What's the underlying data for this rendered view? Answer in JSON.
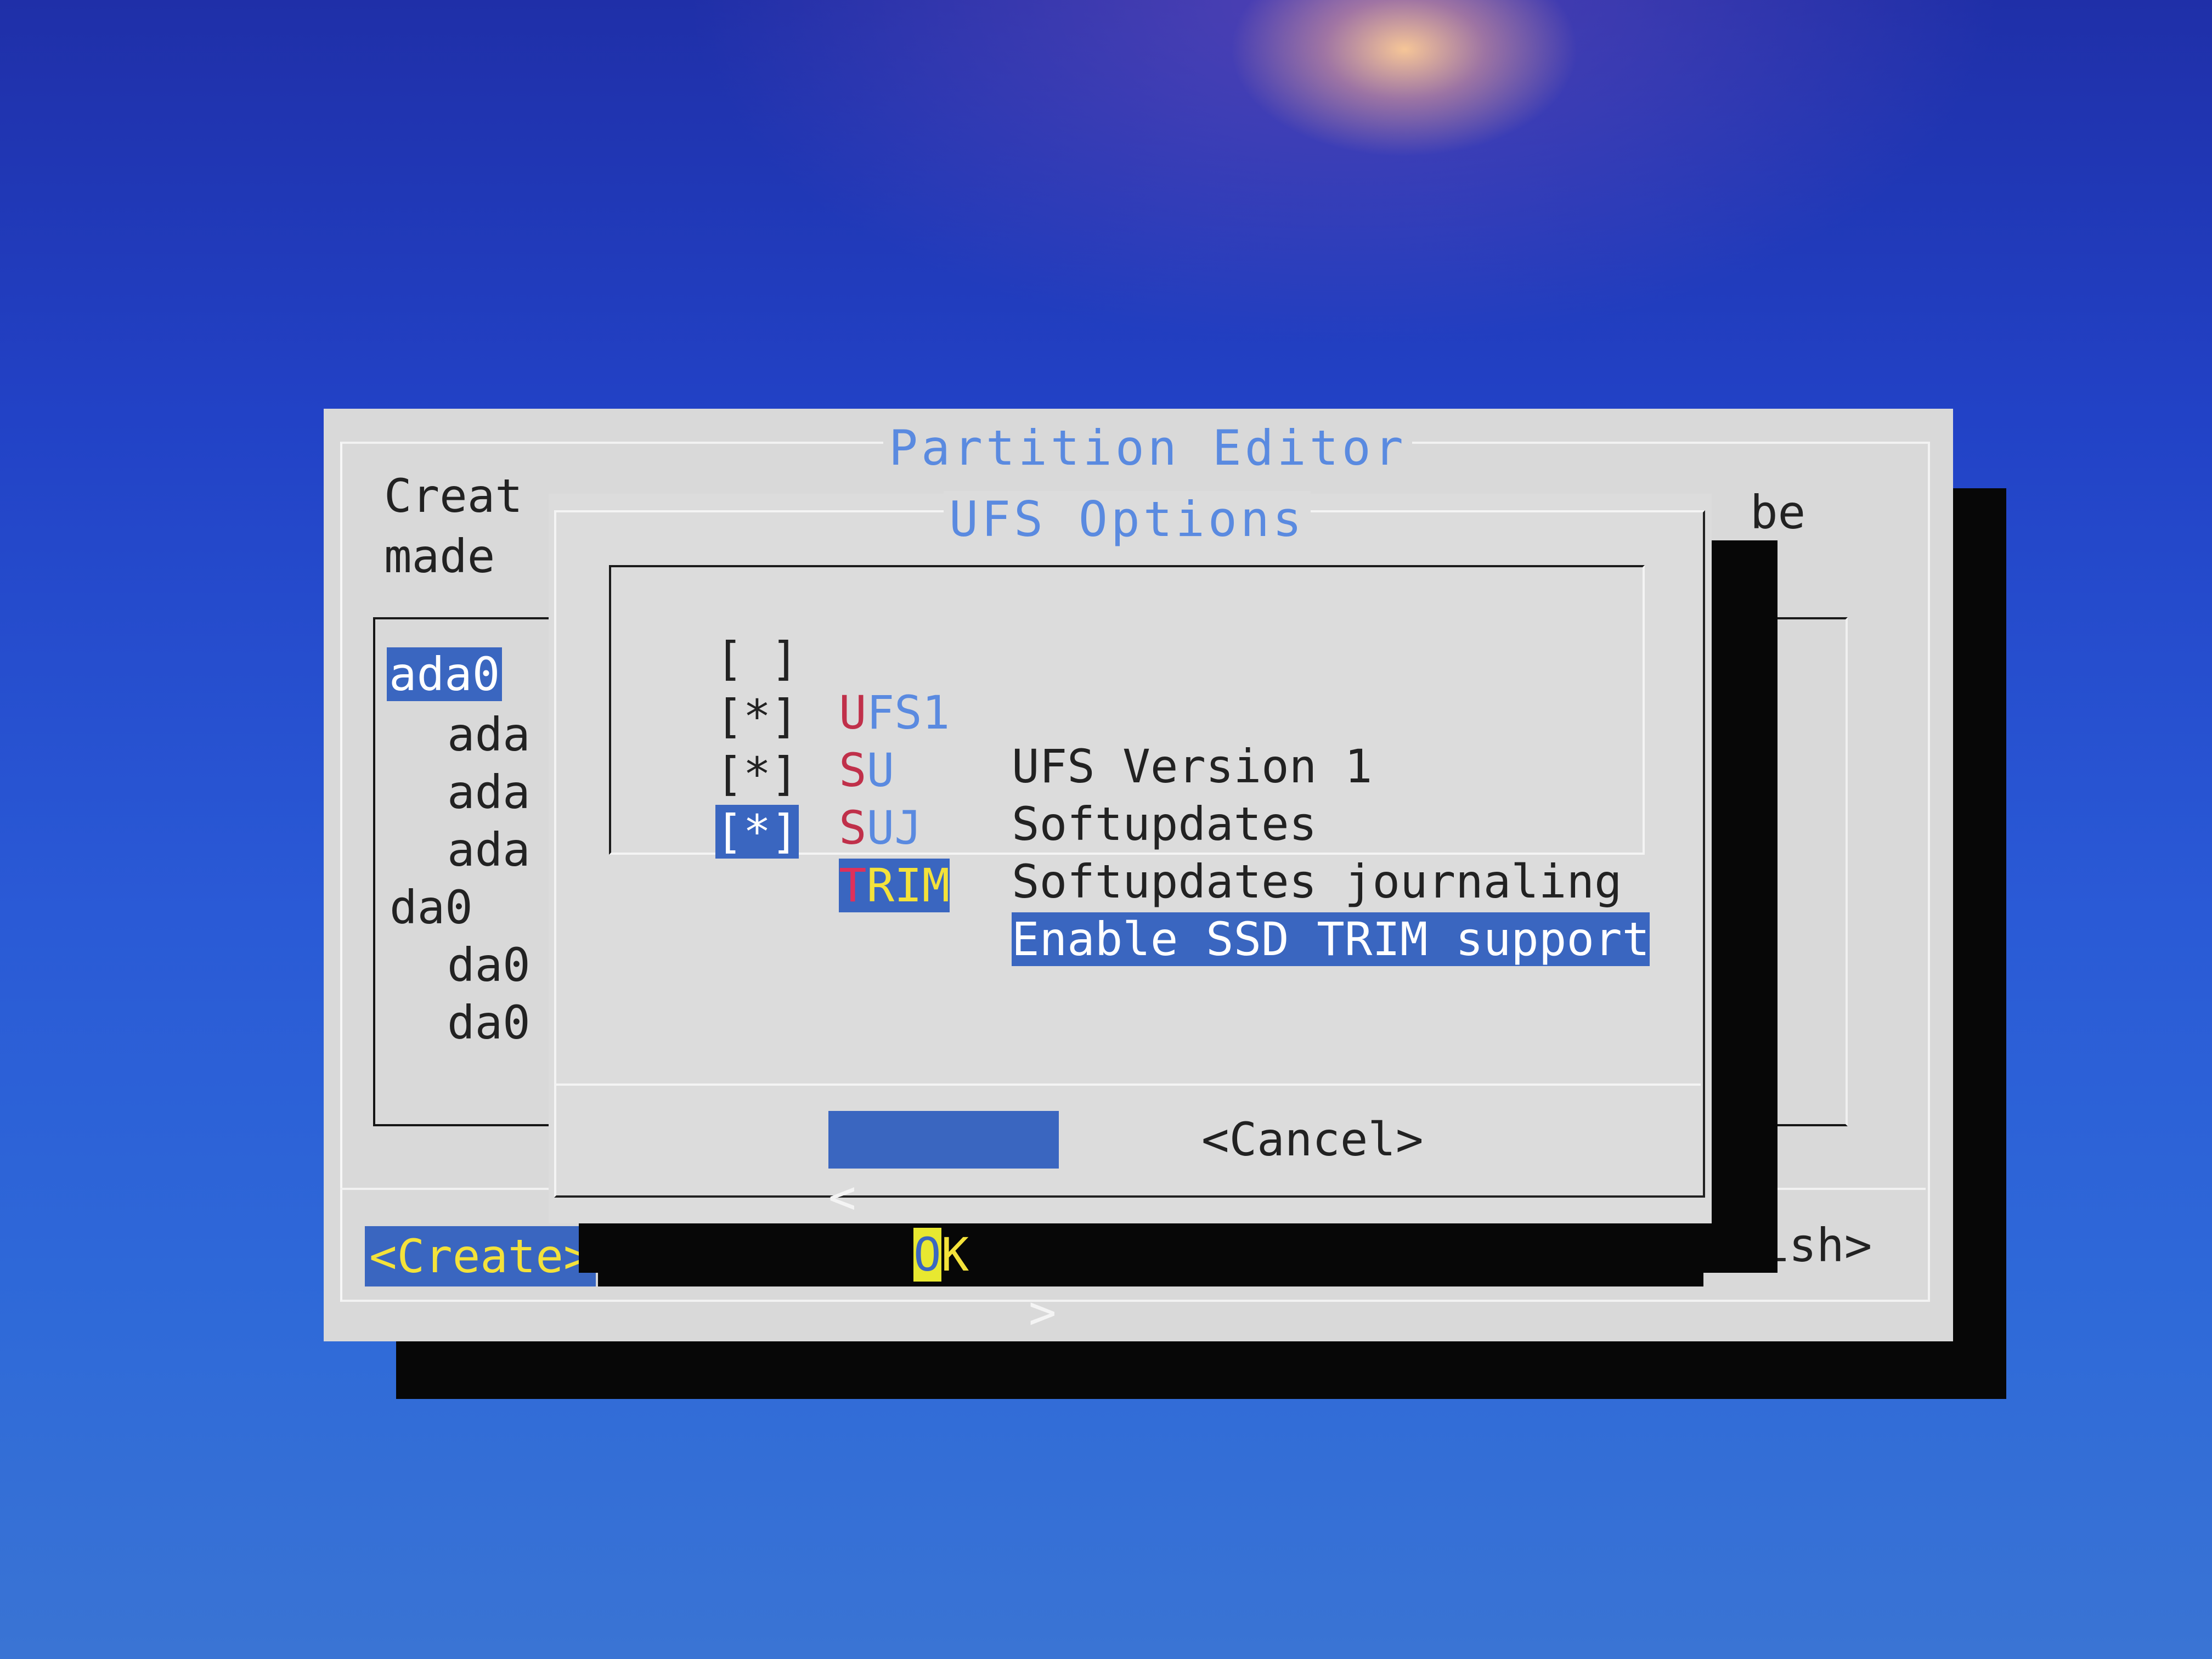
{
  "outer_dialog": {
    "title": "Partition Editor",
    "description_line1": "Creat",
    "description_line2": "made",
    "description_right": "be",
    "disks": [
      "ada0",
      "ada",
      "ada",
      "ada",
      "da0",
      "da0",
      "da0"
    ],
    "buttons": {
      "create": "<Create>",
      "finish_partial": "ish>"
    }
  },
  "ufs_dialog": {
    "title": "UFS Options",
    "options": [
      {
        "check": "[ ]",
        "hotkey": "U",
        "name_rest": "FS1",
        "description": "UFS Version 1",
        "selected": false
      },
      {
        "check": "[*]",
        "hotkey": "S",
        "name_rest": "U",
        "description": "Softupdates",
        "selected": false
      },
      {
        "check": "[*]",
        "hotkey": "S",
        "name_rest": "UJ",
        "description": "Softupdates journaling",
        "selected": false
      },
      {
        "check": "[*]",
        "hotkey": "T",
        "name_rest": "RIM",
        "description": "Enable SSD TRIM support",
        "selected": true
      }
    ],
    "buttons": {
      "ok_left": "<",
      "ok_hotkey": "O",
      "ok_rest": "K",
      "ok_right": ">",
      "cancel": "<Cancel>"
    }
  },
  "colors": {
    "background": "#2a5ad6",
    "dialog": "#d9d9d9",
    "highlight": "#3a66c0",
    "title_text": "#5a8ae0",
    "hotkey": "#c0304a",
    "button_text": "#f4e23a"
  }
}
